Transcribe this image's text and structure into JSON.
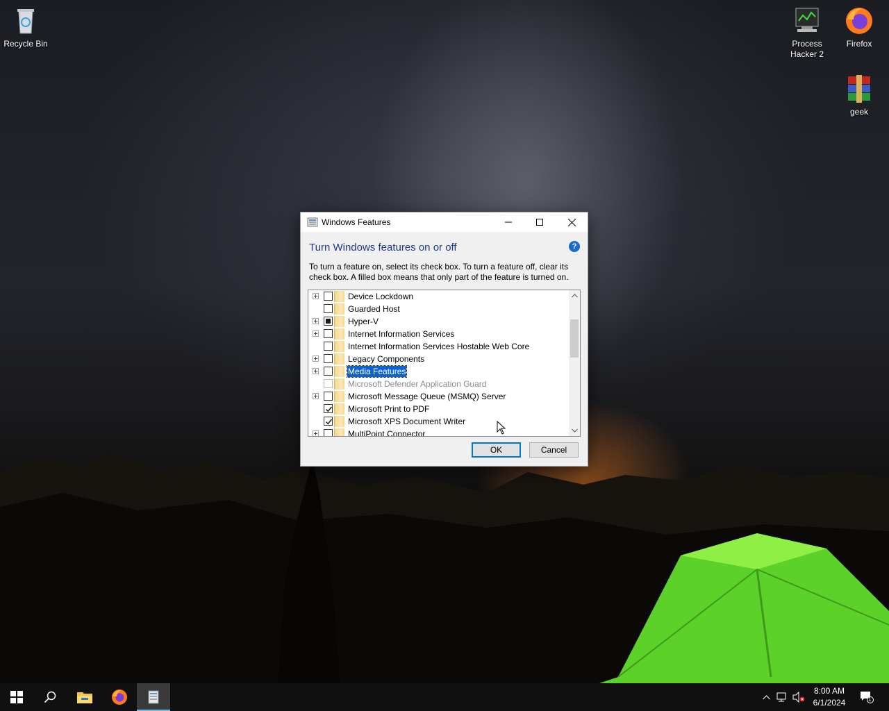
{
  "desktop": {
    "icons": [
      {
        "label": "Recycle Bin",
        "icon": "recycle-bin-icon"
      },
      {
        "label": "Process Hacker 2",
        "icon": "process-hacker-icon"
      },
      {
        "label": "Firefox",
        "icon": "firefox-icon"
      },
      {
        "label": "geek",
        "icon": "winrar-icon"
      }
    ]
  },
  "dialog": {
    "title": "Windows Features",
    "heading": "Turn Windows features on or off",
    "help_label": "?",
    "description": "To turn a feature on, select its check box. To turn a feature off, clear its check box. A filled box means that only part of the feature is turned on.",
    "features": [
      {
        "label": "Device Lockdown",
        "expandable": true,
        "state": "unchecked"
      },
      {
        "label": "Guarded Host",
        "expandable": false,
        "state": "unchecked"
      },
      {
        "label": "Hyper-V",
        "expandable": true,
        "state": "partial"
      },
      {
        "label": "Internet Information Services",
        "expandable": true,
        "state": "unchecked"
      },
      {
        "label": "Internet Information Services Hostable Web Core",
        "expandable": false,
        "state": "unchecked"
      },
      {
        "label": "Legacy Components",
        "expandable": true,
        "state": "unchecked"
      },
      {
        "label": "Media Features",
        "expandable": true,
        "state": "unchecked",
        "selected": true
      },
      {
        "label": "Microsoft Defender Application Guard",
        "expandable": false,
        "state": "disabled"
      },
      {
        "label": "Microsoft Message Queue (MSMQ) Server",
        "expandable": true,
        "state": "unchecked"
      },
      {
        "label": "Microsoft Print to PDF",
        "expandable": false,
        "state": "checked"
      },
      {
        "label": "Microsoft XPS Document Writer",
        "expandable": false,
        "state": "checked"
      },
      {
        "label": "MultiPoint Connector",
        "expandable": true,
        "state": "unchecked"
      }
    ],
    "ok_label": "OK",
    "cancel_label": "Cancel"
  },
  "taskbar": {
    "items": [
      "start-icon",
      "search-icon",
      "file-explorer-icon",
      "firefox-icon",
      "windows-features-icon"
    ],
    "active_item": "windows-features-icon",
    "tray": [
      "chevron-up-icon",
      "network-icon",
      "volume-muted-icon"
    ],
    "time": "8:00 AM",
    "date": "6/1/2024",
    "notification_count": "1"
  },
  "colors": {
    "heading": "#1e3c8c",
    "selection": "#0a64d8",
    "accent": "#0078d7"
  }
}
